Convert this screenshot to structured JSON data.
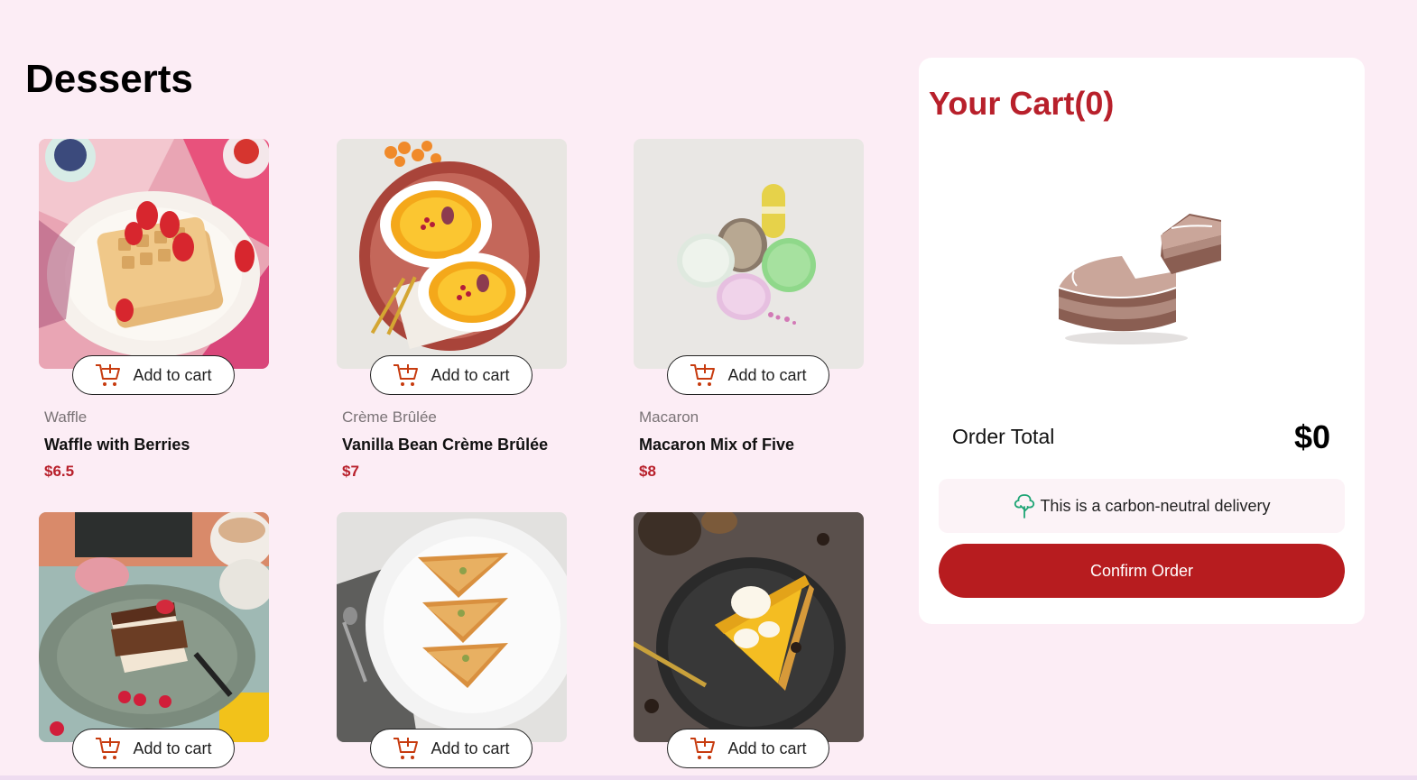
{
  "page": {
    "title": "Desserts"
  },
  "products": [
    {
      "category": "Waffle",
      "name": "Waffle with Berries",
      "price": "$6.5",
      "button_label": "Add to cart",
      "image_icon": "waffle-photo"
    },
    {
      "category": "Crème Brûlée",
      "name": "Vanilla Bean Crème Brûlée",
      "price": "$7",
      "button_label": "Add to cart",
      "image_icon": "creme-brulee-photo"
    },
    {
      "category": "Macaron",
      "name": "Macaron Mix of Five",
      "price": "$8",
      "button_label": "Add to cart",
      "image_icon": "macaron-photo"
    },
    {
      "category": "",
      "name": "",
      "price": "",
      "button_label": "Add to cart",
      "image_icon": "tiramisu-photo"
    },
    {
      "category": "",
      "name": "",
      "price": "",
      "button_label": "Add to cart",
      "image_icon": "baklava-photo"
    },
    {
      "category": "",
      "name": "",
      "price": "",
      "button_label": "Add to cart",
      "image_icon": "pie-photo"
    }
  ],
  "cart": {
    "title": "Your Cart(0)",
    "order_total_label": "Order Total",
    "order_total_value": "$0",
    "carbon_note": "This is a carbon-neutral delivery",
    "confirm_label": "Confirm Order",
    "illustration_icon": "empty-cart-cake-illustration"
  },
  "colors": {
    "background": "#fcedf5",
    "accent_red": "#b8202b",
    "confirm_button": "#b71c1f",
    "cart_icon": "#c73b0f",
    "carbon_icon": "#1ea575"
  }
}
